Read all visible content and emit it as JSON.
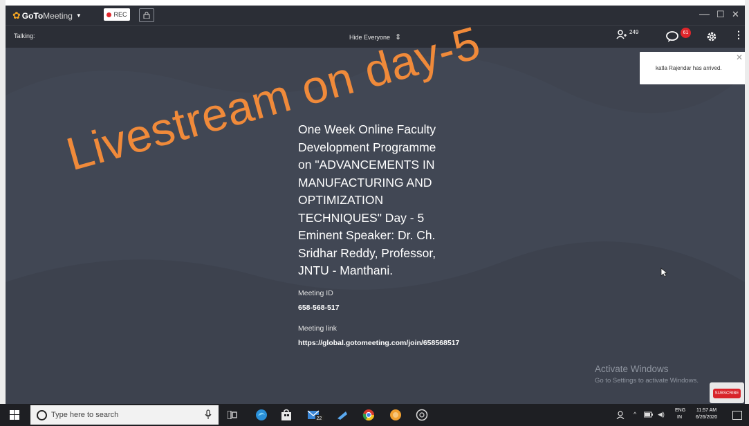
{
  "titlebar": {
    "brand_goto": "GoTo",
    "brand_meeting": "Meeting",
    "rec_label": "REC",
    "minimize": "—",
    "maximize": "☐",
    "close": "✕"
  },
  "toolbar": {
    "talking": "Talking:",
    "hide_everyone": "Hide Everyone",
    "attendee_count": "249",
    "chat_badge": "61"
  },
  "notification": {
    "message": "katla Rajendar has arrived.",
    "close": "✕"
  },
  "overlay": {
    "livestream": "Livestream on day-5",
    "color": "#f08a3a"
  },
  "presentation": {
    "lines": [
      "One Week Online Faculty",
      "Development Programme",
      "on \"ADVANCEMENTS IN",
      "MANUFACTURING AND",
      "OPTIMIZATION",
      "TECHNIQUES\" Day - 5",
      "Eminent Speaker: Dr. Ch.",
      "Sridhar Reddy, Professor,",
      "JNTU - Manthani."
    ],
    "meeting_id_label": "Meeting ID",
    "meeting_id": "658-568-517",
    "meeting_link_label": "Meeting link",
    "meeting_link": "https://global.gotomeeting.com/join/658568517"
  },
  "watermark": {
    "title": "Activate Windows",
    "subtitle": "Go to Settings to activate Windows."
  },
  "youtube": {
    "label": "SUBSCRIBE"
  },
  "taskbar": {
    "search_placeholder": "Type here to search",
    "mail_badge": "22",
    "lang_line1": "ENG",
    "lang_line2": "IN",
    "time": "11:57 AM",
    "date": "6/26/2020"
  },
  "colors": {
    "app_bg": "#3f4450",
    "bar_bg": "#2b2e36",
    "rec_red": "#e0262b",
    "accent_orange": "#f5a623"
  }
}
